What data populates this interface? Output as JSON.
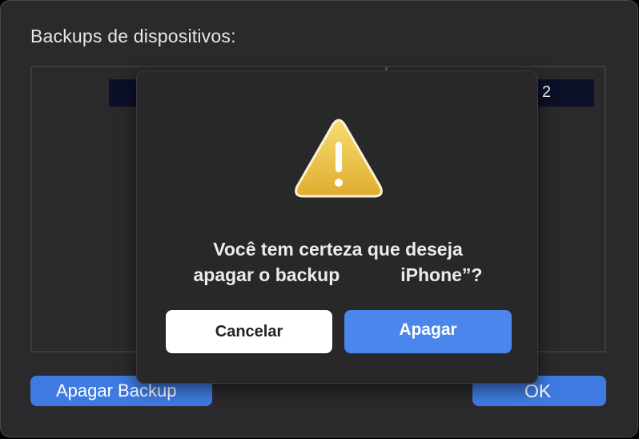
{
  "window": {
    "section_label": "Backups de dispositivos:",
    "list": {
      "row_left_text": "",
      "row_right_text": "2"
    },
    "delete_backup_button": "Apagar Backup",
    "ok_button": "OK"
  },
  "alert": {
    "icon": "warning-icon",
    "message_line1": "Você tem certeza que deseja",
    "message_line2_part1": "apagar o backup",
    "message_line2_part2": "iPhone”?",
    "cancel_button": "Cancelar",
    "confirm_button": "Apagar"
  },
  "colors": {
    "accent_blue": "#3f7ae0",
    "confirm_blue": "#4b86ec",
    "warning_yellow": "#f1c84b",
    "window_bg": "#2a2a2d"
  }
}
